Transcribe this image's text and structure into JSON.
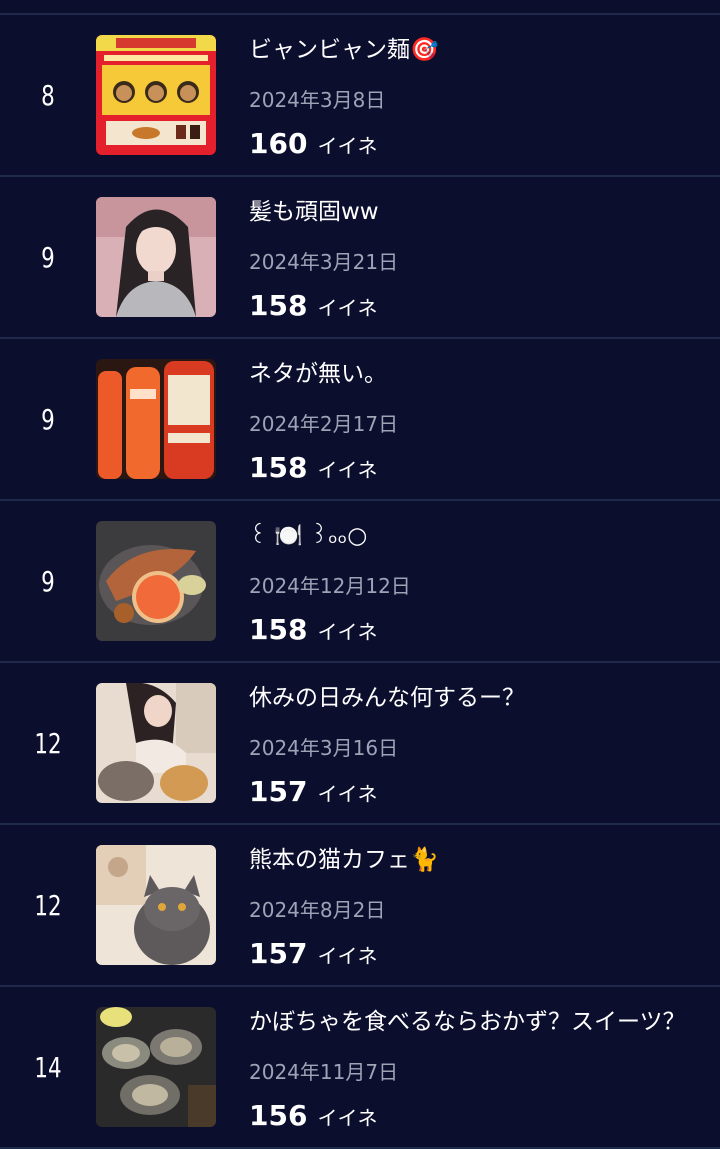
{
  "like_unit": "イイネ",
  "posts": [
    {
      "rank": "8",
      "title": "ビャンビャン麺🎯",
      "date": "2024年3月8日",
      "likes": "160",
      "thumb": "promo-poster"
    },
    {
      "rank": "9",
      "title": "髪も頑固ww",
      "date": "2024年3月21日",
      "likes": "158",
      "thumb": "woman-selfie"
    },
    {
      "rank": "9",
      "title": "ネタが無い。",
      "date": "2024年2月17日",
      "likes": "158",
      "thumb": "drink-bottles"
    },
    {
      "rank": "9",
      "title": "꒰ 🍽️ ꒱ₒₒ○",
      "date": "2024年12月12日",
      "likes": "158",
      "thumb": "seafood-plate"
    },
    {
      "rank": "12",
      "title": "休みの日みんな何するー？",
      "date": "2024年3月16日",
      "likes": "157",
      "thumb": "woman-with-cats"
    },
    {
      "rank": "12",
      "title": "熊本の猫カフェ🐈",
      "date": "2024年8月2日",
      "likes": "157",
      "thumb": "grey-cat"
    },
    {
      "rank": "14",
      "title": "かぼちゃを食べるならおかず？スイーツ？",
      "date": "2024年11月7日",
      "likes": "156",
      "thumb": "oysters"
    }
  ]
}
